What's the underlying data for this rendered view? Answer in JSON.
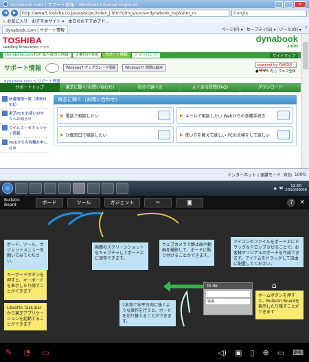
{
  "browser": {
    "title": "dynabook.com | サポート情報 - Windows Internet Explorer",
    "address": "http://www3.toshiba.co.jp/assist/pc/index_j.htm?utm_source=dynabook_top&utm_m",
    "search_engine": "Google",
    "favorites_label": "お気に入り",
    "fav_items": [
      "おすすめサイト ▾",
      "本日のおすすめアド..."
    ],
    "tab_label": "dynabook.com | サポート情報",
    "commands": [
      "ページ(P) ▾",
      "セーフティ(S) ▾",
      "ツール(O) ▾",
      "?"
    ],
    "status_text": "インターネット | 保護モード: 有効",
    "zoom": "100%"
  },
  "site": {
    "brand": "TOSHIBA",
    "tagline": "Leading Innovation >>>",
    "logo_main": "dynabook",
    "logo_sub": ".com",
    "green_tabs": [
      "dynabook.comTOP 個人者向け情報",
      "企業向け情報",
      "サポート情報",
      "ショッピング"
    ],
    "sitemap": "サイトマップ",
    "support_title": "サポート情報",
    "badge_windows7": "Windows7",
    "badge_windows7_sub": "アップグレード情報",
    "badge_vista": "Windows7?",
    "badge_vista_sub": "問題は解決",
    "yahoo_label": "powered by YAHOO! JAPAN",
    "radio_site": "● サイト内",
    "radio_web": "○ ウェブ全体",
    "breadcrumb": "dynabook.com > サポート情報",
    "nav": [
      "サポートトップ",
      "東芝に聞く(お問い合わせ)",
      "自分で調べる",
      "よくある質問(FAQ)",
      "ダウンロード"
    ],
    "sidebar": [
      "新着情報一覧（更新日9/6）",
      "東芝PCをお使いのかたへお知らせ",
      "ウイルス・セキュリティ情報",
      "Webからの各種お申し込み"
    ],
    "ask_title": "東芝に聞く（お問い合わせ）",
    "ask_cards": [
      "電話で相談したい",
      "メールで相談したい Webからの各種手続き",
      "対面窓口で相談したい",
      "使い方を教えて欲しい PCの点検をして欲しい"
    ]
  },
  "taskbar": {
    "time": "12:50",
    "date": "2010/09/06"
  },
  "bulletin": {
    "title": "Bulletin Board",
    "buttons": [
      "ボード",
      "ツール",
      "ガジェット"
    ],
    "help": "?",
    "notes": {
      "n1": "ボード、ツール、ガジェットメニューを開いてみてください。",
      "n2": "画面のスクリーンショットをキャプチャしてボード上に保存できます。",
      "n3": "ウェブカメラで静止画や動画を撮影して、ボードに貼り付けることができます。",
      "n4": "アイコンやファイルをボード上にドラッグ＆ドロップさせることで、お客様オリジナルのボードを作成できます。アイテムをドラッグして自由に配置してください。",
      "n5": "キーボードボタンを押すと、キーボードを表示したり隠すことができます",
      "n6": "Libretto Task Barから東芝アプリケーションを起動することができます",
      "n7": "1本指で水平方向に強くような操作を行うと、ボードを切り替えることができます。",
      "n8": "ホームボタンを押すと、Bulletin Boardを表示したり隠すことができます"
    },
    "todo_title": "To do",
    "todo_add": "追加…"
  }
}
